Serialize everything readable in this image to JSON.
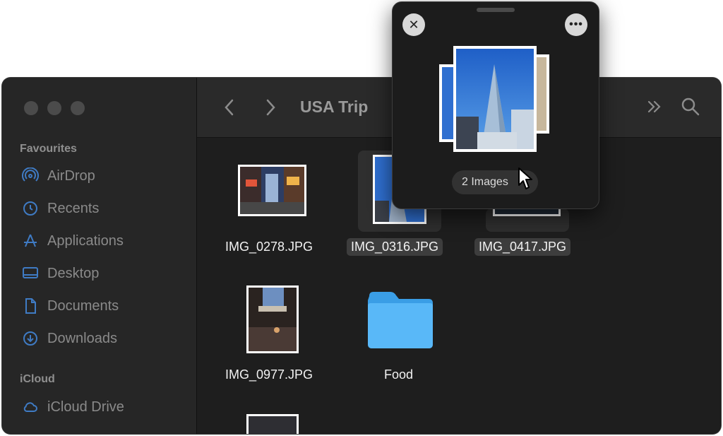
{
  "sidebar": {
    "sections": [
      {
        "title": "Favourites",
        "items": [
          {
            "label": "AirDrop",
            "icon": "airdrop-icon"
          },
          {
            "label": "Recents",
            "icon": "clock-icon"
          },
          {
            "label": "Applications",
            "icon": "applications-icon"
          },
          {
            "label": "Desktop",
            "icon": "desktop-icon"
          },
          {
            "label": "Documents",
            "icon": "document-icon"
          },
          {
            "label": "Downloads",
            "icon": "download-icon"
          }
        ]
      },
      {
        "title": "iCloud",
        "items": [
          {
            "label": "iCloud Drive",
            "icon": "cloud-icon"
          }
        ]
      }
    ]
  },
  "toolbar": {
    "title": "USA Trip",
    "back_icon": "chevron-left-icon",
    "forward_icon": "chevron-right-icon",
    "overflow_icon": "double-chevron-icon",
    "search_icon": "search-icon"
  },
  "files": [
    {
      "name": "IMG_0278.JPG",
      "selected": false
    },
    {
      "name": "IMG_0316.JPG",
      "selected": true
    },
    {
      "name": "IMG_0417.JPG",
      "selected": true
    },
    {
      "name": "IMG_0977.JPG",
      "selected": false
    },
    {
      "name": "Food",
      "selected": false,
      "kind": "folder"
    }
  ],
  "popover": {
    "close_icon": "close-icon",
    "more_icon": "more-icon",
    "badge": "2 Images"
  },
  "colors": {
    "folder": "#4fb3f5",
    "window": "#1e1e1e",
    "sidebar": "#262626"
  }
}
